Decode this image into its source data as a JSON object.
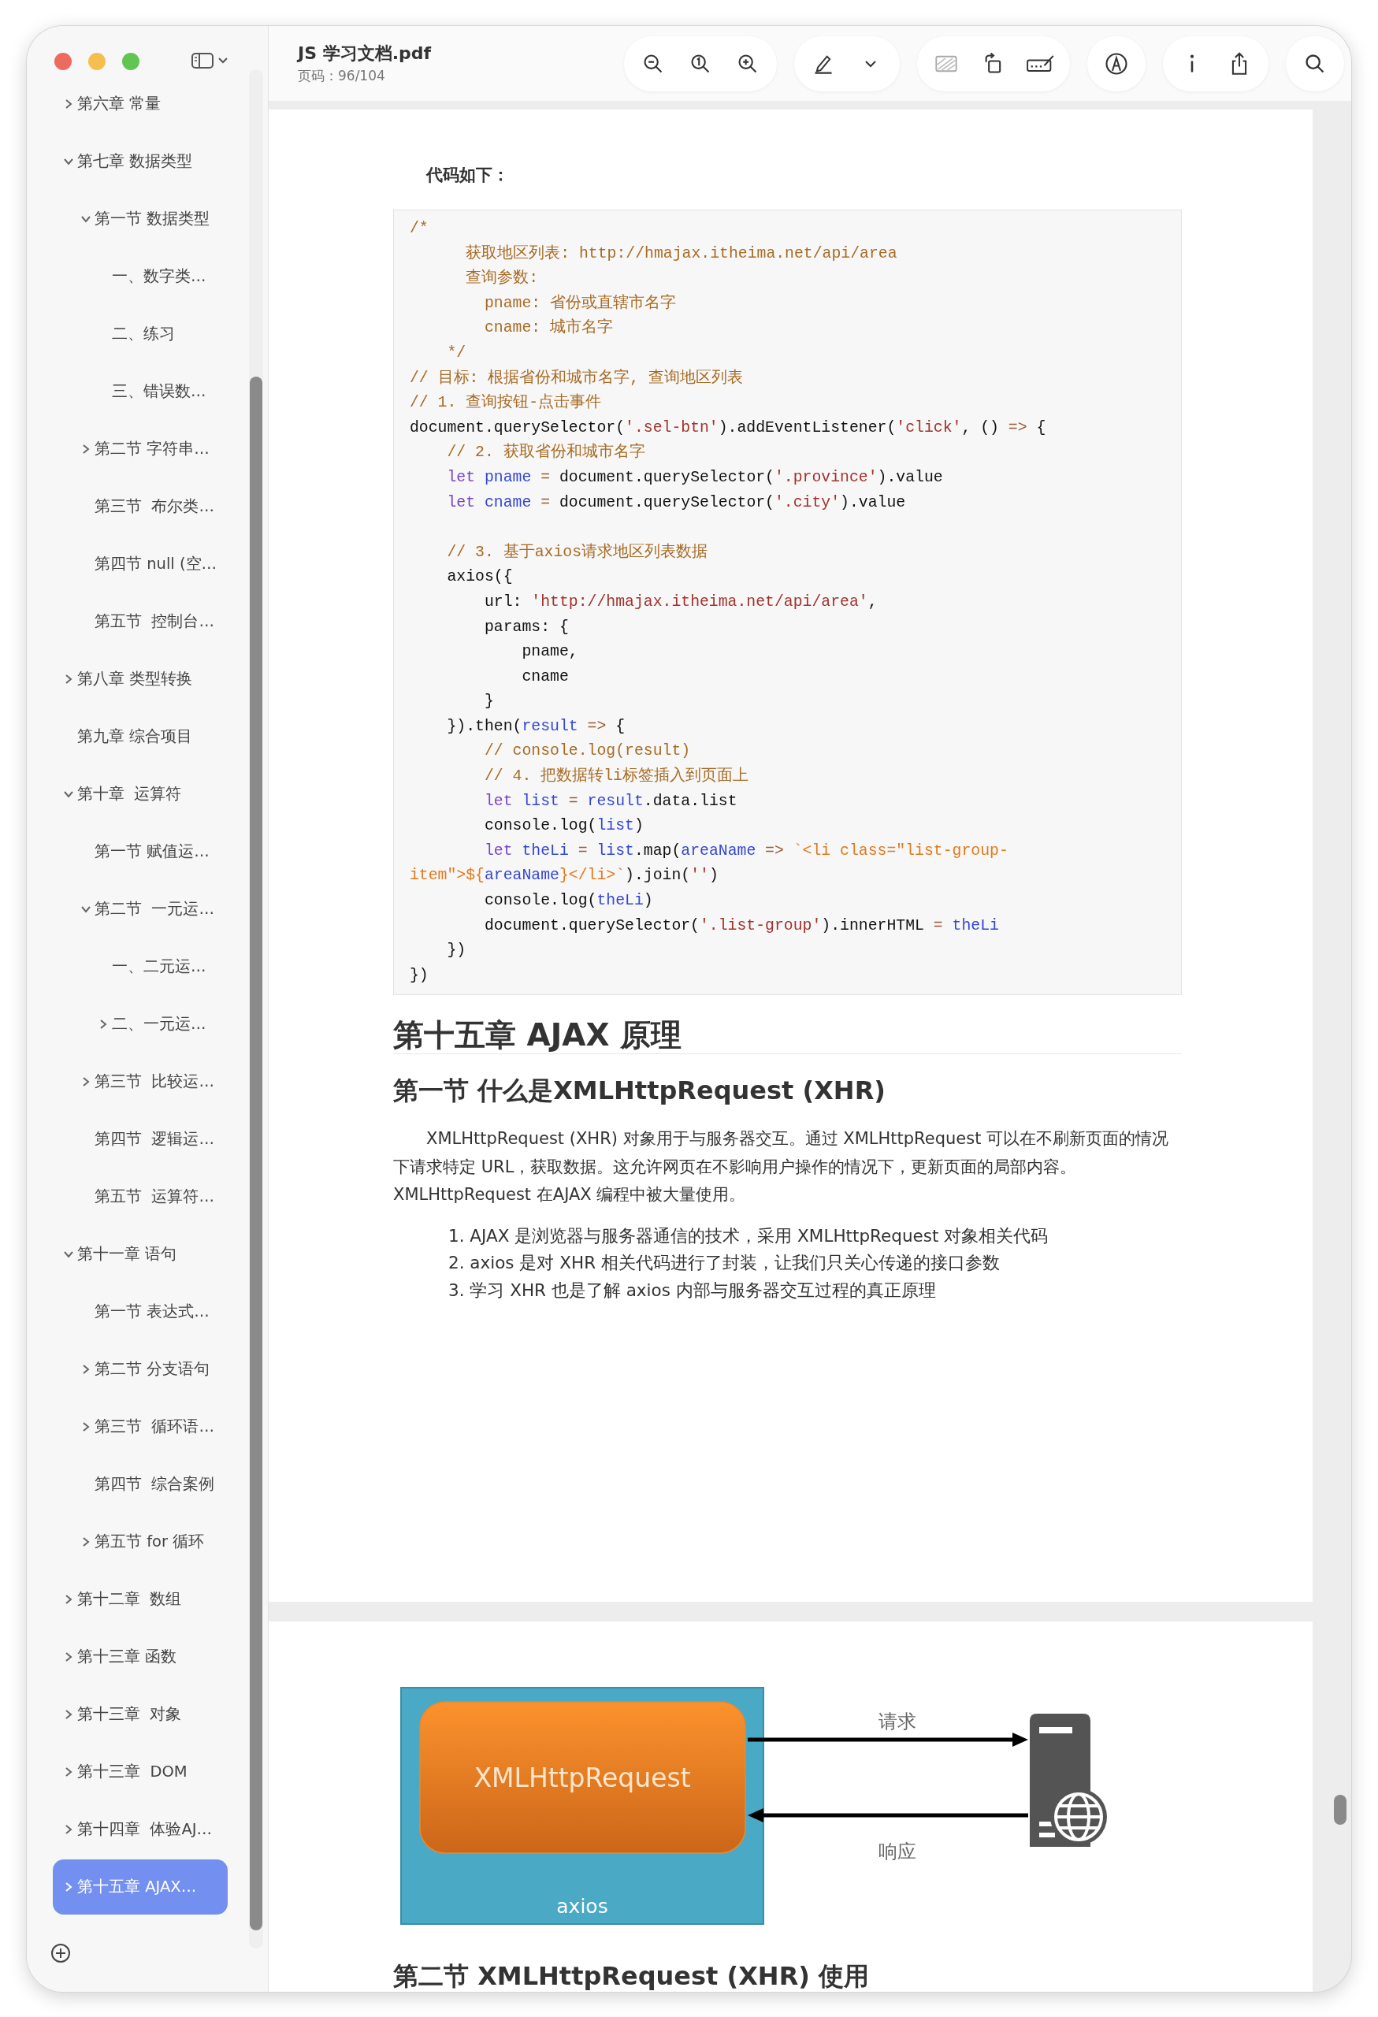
{
  "window": {
    "title": "JS 学习文档.pdf",
    "subtitle": "页码：96/104"
  },
  "sidebar": {
    "items": [
      {
        "label": "第六章 常量",
        "kind": "branch",
        "expanded": false,
        "selected": false
      },
      {
        "label": "第七章 数据类型",
        "kind": "branch",
        "expanded": true,
        "selected": false,
        "children": [
          {
            "label": "第一节 数据类型",
            "kind": "branch",
            "expanded": true,
            "selected": false,
            "children": [
              {
                "label": "一、数字类…",
                "kind": "leaf",
                "selected": false
              },
              {
                "label": "二、练习",
                "kind": "leaf",
                "selected": false
              },
              {
                "label": "三、错误数…",
                "kind": "leaf",
                "selected": false
              }
            ]
          },
          {
            "label": "第二节 字符串…",
            "kind": "branch",
            "expanded": false,
            "selected": false
          },
          {
            "label": "第三节  布尔类…",
            "kind": "leaf",
            "selected": false
          },
          {
            "label": "第四节 null (空…",
            "kind": "leaf",
            "selected": false
          },
          {
            "label": "第五节  控制台…",
            "kind": "leaf",
            "selected": false
          }
        ]
      },
      {
        "label": "第八章 类型转换",
        "kind": "branch",
        "expanded": false,
        "selected": false
      },
      {
        "label": "第九章 综合项目",
        "kind": "leaf",
        "selected": false
      },
      {
        "label": "第十章  运算符",
        "kind": "branch",
        "expanded": true,
        "selected": false,
        "children": [
          {
            "label": "第一节 赋值运…",
            "kind": "leaf",
            "selected": false
          },
          {
            "label": "第二节  一元运…",
            "kind": "branch",
            "expanded": true,
            "selected": false,
            "children": [
              {
                "label": "一、二元运…",
                "kind": "leaf",
                "selected": false
              },
              {
                "label": "二、一元运…",
                "kind": "branch",
                "expanded": false,
                "selected": false
              }
            ]
          },
          {
            "label": "第三节  比较运…",
            "kind": "branch",
            "expanded": false,
            "selected": false
          },
          {
            "label": "第四节  逻辑运…",
            "kind": "leaf",
            "selected": false
          },
          {
            "label": "第五节  运算符…",
            "kind": "leaf",
            "selected": false
          }
        ]
      },
      {
        "label": "第十一章 语句",
        "kind": "branch",
        "expanded": true,
        "selected": false,
        "children": [
          {
            "label": "第一节 表达式…",
            "kind": "leaf",
            "selected": false
          },
          {
            "label": "第二节 分支语句",
            "kind": "branch",
            "expanded": false,
            "selected": false
          },
          {
            "label": "第三节  循环语…",
            "kind": "branch",
            "expanded": false,
            "selected": false
          },
          {
            "label": "第四节  综合案例",
            "kind": "leaf",
            "selected": false
          },
          {
            "label": "第五节 for 循环",
            "kind": "branch",
            "expanded": false,
            "selected": false
          }
        ]
      },
      {
        "label": "第十二章  数组",
        "kind": "branch",
        "expanded": false,
        "selected": false
      },
      {
        "label": "第十三章 函数",
        "kind": "branch",
        "expanded": false,
        "selected": false
      },
      {
        "label": "第十三章  对象",
        "kind": "branch",
        "expanded": false,
        "selected": false
      },
      {
        "label": "第十三章  DOM",
        "kind": "branch",
        "expanded": false,
        "selected": false
      },
      {
        "label": "第十四章  体验AJ…",
        "kind": "branch",
        "expanded": false,
        "selected": false
      },
      {
        "label": "第十五章 AJAX…",
        "kind": "branch",
        "expanded": false,
        "selected": true
      }
    ]
  },
  "page_1": {
    "label": "代码如下：",
    "code_lines": [
      {
        "kind": "code",
        "tokens": [
          {
            "kind": "comment",
            "text": "/*"
          }
        ]
      },
      {
        "kind": "code",
        "tokens": [
          {
            "kind": "comment",
            "text": "      获取地区列表: http://hmajax.itheima.net/api/area"
          }
        ]
      },
      {
        "kind": "code",
        "tokens": [
          {
            "kind": "comment",
            "text": "      查询参数:"
          }
        ]
      },
      {
        "kind": "code",
        "tokens": [
          {
            "kind": "comment",
            "text": "        pname: 省份或直辖市名字"
          }
        ]
      },
      {
        "kind": "code",
        "tokens": [
          {
            "kind": "comment",
            "text": "        cname: 城市名字"
          }
        ]
      },
      {
        "kind": "code",
        "tokens": [
          {
            "kind": "comment",
            "text": "    */"
          }
        ]
      },
      {
        "kind": "code",
        "tokens": [
          {
            "kind": "comment",
            "text": "// 目标: 根据省份和城市名字, 查询地区列表"
          }
        ]
      },
      {
        "kind": "code",
        "tokens": [
          {
            "kind": "comment",
            "text": "// 1. 查询按钮-点击事件"
          }
        ]
      },
      {
        "kind": "code",
        "tokens": [
          {
            "kind": "plain",
            "text": "document.querySelector("
          },
          {
            "kind": "string",
            "text": "'.sel-btn'"
          },
          {
            "kind": "plain",
            "text": ").addEventListener("
          },
          {
            "kind": "string",
            "text": "'click'"
          },
          {
            "kind": "plain",
            "text": ", () "
          },
          {
            "kind": "operator",
            "text": "=>"
          },
          {
            "kind": "plain",
            "text": " {"
          }
        ]
      },
      {
        "kind": "code",
        "tokens": [
          {
            "kind": "comment",
            "text": "    // 2. 获取省份和城市名字"
          }
        ]
      },
      {
        "kind": "code",
        "tokens": [
          {
            "kind": "keyword",
            "text": "    let"
          },
          {
            "kind": "variable",
            "text": " pname"
          },
          {
            "kind": "operator",
            "text": " ="
          },
          {
            "kind": "plain",
            "text": " document.querySelector("
          },
          {
            "kind": "string",
            "text": "'.province'"
          },
          {
            "kind": "plain",
            "text": ").value"
          }
        ]
      },
      {
        "kind": "code",
        "tokens": [
          {
            "kind": "keyword",
            "text": "    let"
          },
          {
            "kind": "variable",
            "text": " cname"
          },
          {
            "kind": "operator",
            "text": " ="
          },
          {
            "kind": "plain",
            "text": " document.querySelector("
          },
          {
            "kind": "string",
            "text": "'.city'"
          },
          {
            "kind": "plain",
            "text": ").value"
          }
        ]
      },
      {
        "kind": "blank"
      },
      {
        "kind": "code",
        "tokens": [
          {
            "kind": "comment",
            "text": "    // 3. 基于axios请求地区列表数据"
          }
        ]
      },
      {
        "kind": "code",
        "tokens": [
          {
            "kind": "plain",
            "text": "    axios({"
          }
        ]
      },
      {
        "kind": "code",
        "tokens": [
          {
            "kind": "plain",
            "text": "        url: "
          },
          {
            "kind": "string",
            "text": "'http://hmajax.itheima.net/api/area'"
          },
          {
            "kind": "plain",
            "text": ","
          }
        ]
      },
      {
        "kind": "code",
        "tokens": [
          {
            "kind": "plain",
            "text": "        params: {"
          }
        ]
      },
      {
        "kind": "code",
        "tokens": [
          {
            "kind": "plain",
            "text": "            pname,"
          }
        ]
      },
      {
        "kind": "code",
        "tokens": [
          {
            "kind": "plain",
            "text": "            cname"
          }
        ]
      },
      {
        "kind": "code",
        "tokens": [
          {
            "kind": "plain",
            "text": "        }"
          }
        ]
      },
      {
        "kind": "code",
        "tokens": [
          {
            "kind": "plain",
            "text": "    }).then("
          },
          {
            "kind": "variable",
            "text": "result"
          },
          {
            "kind": "operator",
            "text": " =>"
          },
          {
            "kind": "plain",
            "text": " {"
          }
        ]
      },
      {
        "kind": "code",
        "tokens": [
          {
            "kind": "comment",
            "text": "        // console.log(result)"
          }
        ]
      },
      {
        "kind": "code",
        "tokens": [
          {
            "kind": "comment",
            "text": "        // 4. 把数据转li标签插入到页面上"
          }
        ]
      },
      {
        "kind": "code",
        "tokens": [
          {
            "kind": "keyword",
            "text": "        let"
          },
          {
            "kind": "variable",
            "text": " list"
          },
          {
            "kind": "operator",
            "text": " ="
          },
          {
            "kind": "variable",
            "text": " result"
          },
          {
            "kind": "plain",
            "text": ".data.list"
          }
        ]
      },
      {
        "kind": "code",
        "tokens": [
          {
            "kind": "plain",
            "text": "        console.log("
          },
          {
            "kind": "variable",
            "text": "list"
          },
          {
            "kind": "plain",
            "text": ")"
          }
        ]
      },
      {
        "kind": "code",
        "tokens": [
          {
            "kind": "keyword",
            "text": "        let"
          },
          {
            "kind": "variable",
            "text": " theLi"
          },
          {
            "kind": "operator",
            "text": " ="
          },
          {
            "kind": "variable",
            "text": " list"
          },
          {
            "kind": "plain",
            "text": ".map("
          },
          {
            "kind": "variable",
            "text": "areaName"
          },
          {
            "kind": "operator",
            "text": " =>"
          },
          {
            "kind": "template",
            "text": " `<li class=\"list-group-"
          }
        ]
      },
      {
        "kind": "code",
        "tokens": [
          {
            "kind": "template",
            "text": "item\">${"
          },
          {
            "kind": "variable",
            "text": "areaName"
          },
          {
            "kind": "template",
            "text": "}</li>`"
          },
          {
            "kind": "plain",
            "text": ").join("
          },
          {
            "kind": "string",
            "text": "''"
          },
          {
            "kind": "plain",
            "text": ")"
          }
        ]
      },
      {
        "kind": "code",
        "tokens": [
          {
            "kind": "plain",
            "text": "        console.log("
          },
          {
            "kind": "variable",
            "text": "theLi"
          },
          {
            "kind": "plain",
            "text": ")"
          }
        ]
      },
      {
        "kind": "code",
        "tokens": [
          {
            "kind": "plain",
            "text": "        document.querySelector("
          },
          {
            "kind": "string",
            "text": "'.list-group'"
          },
          {
            "kind": "plain",
            "text": ").innerHTML "
          },
          {
            "kind": "operator",
            "text": "="
          },
          {
            "kind": "variable",
            "text": " theLi"
          }
        ]
      },
      {
        "kind": "code",
        "tokens": [
          {
            "kind": "plain",
            "text": "    })"
          }
        ]
      },
      {
        "kind": "code",
        "tokens": [
          {
            "kind": "plain",
            "text": "})"
          }
        ]
      }
    ],
    "heading": "第十五章 AJAX 原理",
    "section_title": "第一节 什么是XMLHttpRequest (XHR)",
    "paragraph": "XMLHttpRequest (XHR) 对象用于与服务器交互。通过 XMLHttpRequest 可以在不刷新页面的情况下请求特定 URL，获取数据。这允许网页在不影响用户操作的情况下，更新页面的局部内容。XMLHttpRequest 在AJAX 编程中被大量使用。",
    "list": [
      "1. AJAX 是浏览器与服务器通信的技术，采用 XMLHttpRequest 对象相关代码",
      "2. axios 是对 XHR 相关代码进行了封装，让我们只关心传递的接口参数",
      "3. 学习 XHR 也是了解 axios 内部与服务器交互过程的真正原理"
    ]
  },
  "page_2": {
    "diagram": {
      "outer_label": "axios",
      "inner_label": "XMLHttpRequest",
      "request_label": "请求",
      "response_label": "响应"
    },
    "section_title": "第二节 XMLHttpRequest (XHR) 使用"
  }
}
